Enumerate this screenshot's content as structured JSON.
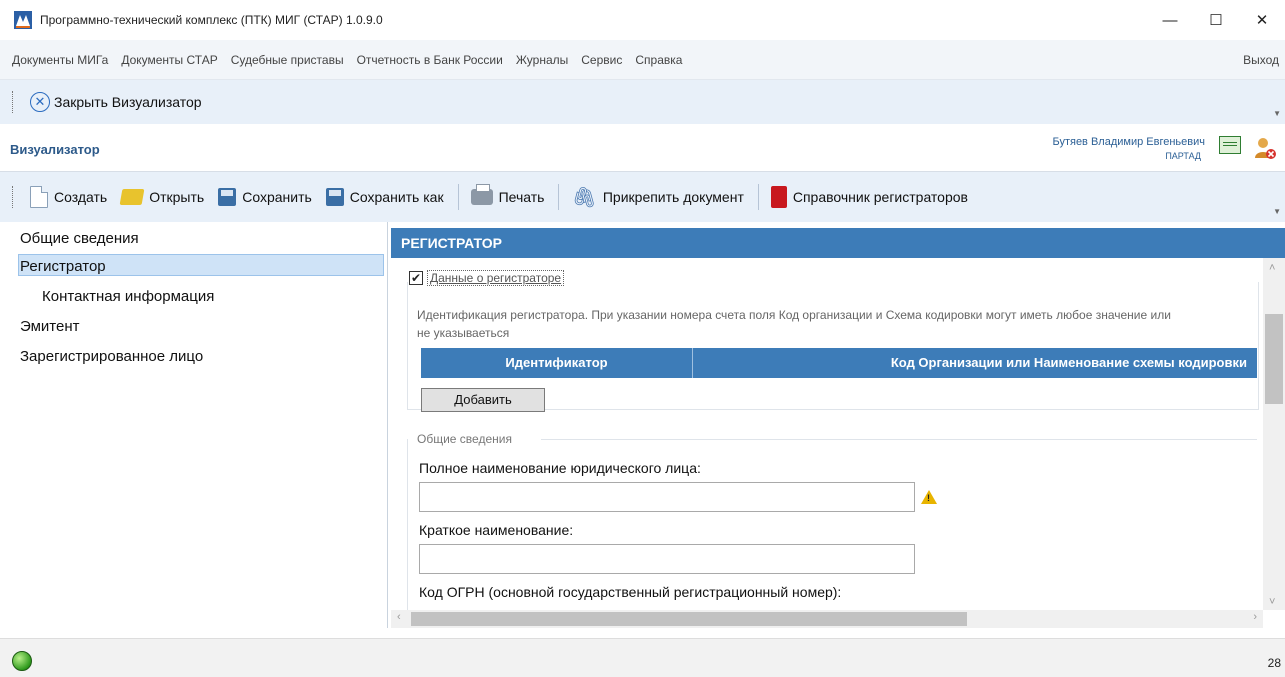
{
  "window": {
    "title": "Программно-технический комплекс (ПТК) МИГ (СТАР) 1.0.9.0",
    "controls": {
      "minimize": "—",
      "maximize": "☐",
      "close": "✕"
    }
  },
  "menu": {
    "items": [
      "Документы МИГа",
      "Документы СТАР",
      "Судебные приставы",
      "Отчетность в Банк России",
      "Журналы",
      "Сервис",
      "Справка"
    ],
    "exit": "Выход"
  },
  "close_bar": {
    "label": "Закрыть Визуализатор",
    "icon": "close-circle-icon"
  },
  "visualizer": {
    "title": "Визуализатор",
    "user_name": "Бутяев Владимир Евгеньевич",
    "user_org": "ПАРТАД"
  },
  "toolbar": {
    "create": "Создать",
    "open": "Открыть",
    "save": "Сохранить",
    "save_as": "Сохранить как",
    "print": "Печать",
    "attach": "Прикрепить документ",
    "registrars": "Справочник регистраторов"
  },
  "nav": {
    "items": [
      "Общие сведения",
      "Регистратор",
      "Контактная информация",
      "Эмитент",
      "Зарегистрированное лицо"
    ],
    "selected": "Регистратор"
  },
  "content": {
    "section_title": "РЕГИСТРАТОР",
    "registrar_checkbox_label": "Данные о регистраторе",
    "registrar_checked": true,
    "identification_text": "Идентификация регистратора. При указании номера счета поля Код организации и Схема кодировки могут иметь любое значение или не указываеться",
    "table_headers": [
      "Идентификатор",
      "Код Организации или Наименование схемы кодировки"
    ],
    "add_button": "Добавить",
    "general_group": "Общие сведения",
    "full_name_label": "Полное наименование юридического лица:",
    "full_name_value": "",
    "short_name_label": "Краткое наименование:",
    "short_name_value": "",
    "ogrn_label": "Код ОГРН (основной государственный регистрационный номер):"
  },
  "status": {
    "number": "28"
  }
}
